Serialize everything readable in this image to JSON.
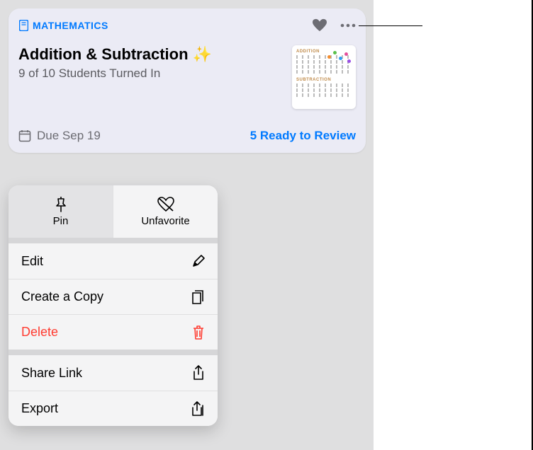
{
  "card": {
    "subject": "MATHEMATICS",
    "title": "Addition & Subtraction ✨",
    "turned_in": "9 of 10 Students Turned In",
    "due": "Due Sep 19",
    "review": "5 Ready to Review",
    "thumb": {
      "h1": "ADDITION",
      "h2": "SUBTRACTION"
    }
  },
  "menu": {
    "pin": "Pin",
    "unfavorite": "Unfavorite",
    "edit": "Edit",
    "copy": "Create a Copy",
    "delete": "Delete",
    "share": "Share Link",
    "export": "Export"
  }
}
